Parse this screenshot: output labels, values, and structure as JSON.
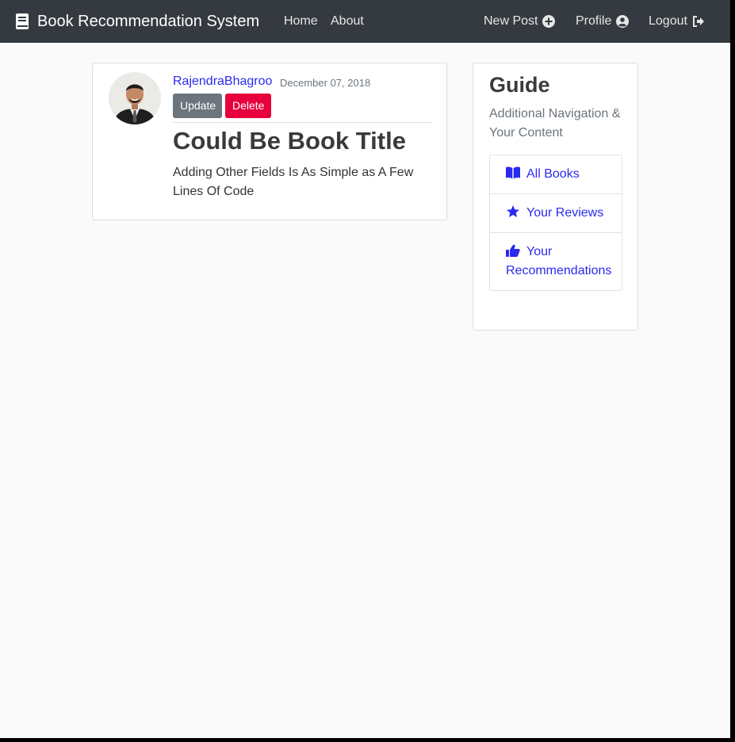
{
  "navbar": {
    "brand": "Book Recommendation System",
    "brand_icon": "book-icon",
    "links": {
      "home": "Home",
      "about": "About",
      "new_post": "New Post",
      "profile": "Profile",
      "logout": "Logout"
    },
    "icons": {
      "new_post": "plus-circle-icon",
      "profile": "user-circle-icon",
      "logout": "sign-out-icon"
    }
  },
  "post": {
    "author": "RajendraBhagroo",
    "date": "December 07, 2018",
    "update_label": "Update",
    "delete_label": "Delete",
    "title": "Could Be Book Title",
    "content": "Adding Other Fields Is As Simple as A Few Lines Of Code"
  },
  "sidebar": {
    "title": "Guide",
    "subtitle": "Additional Navigation & Your Content",
    "items": [
      {
        "label": "All Books",
        "icon": "open-book-icon"
      },
      {
        "label": "Your Reviews",
        "icon": "star-icon"
      },
      {
        "label": "Your Recommendations",
        "icon": "thumbs-up-icon"
      }
    ]
  },
  "colors": {
    "navbar_bg": "#343a40",
    "link": "#2a2af0",
    "secondary": "#6c757d",
    "danger": "#e8003d",
    "page_bg": "#fafafa"
  }
}
